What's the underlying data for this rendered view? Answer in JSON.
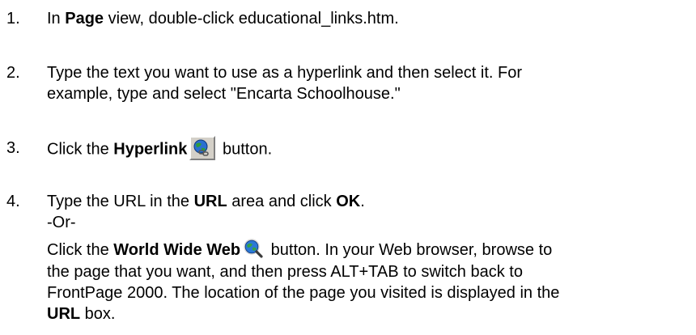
{
  "steps": [
    {
      "number": "1.",
      "p1": "In ",
      "b1": "Page",
      "p2": " view, double-click educational_links.htm."
    },
    {
      "number": "2.",
      "line1": "Type the text you want to use as a hyperlink and then select it. For",
      "line2": "example, type and select \"Encarta Schoolhouse.\""
    },
    {
      "number": "3.",
      "p1": "Click the ",
      "b1": "Hyperlink",
      "icon": "hyperlink-globe-chain-icon",
      "p2": " button."
    },
    {
      "number": "4.",
      "p1": "Type the URL in the ",
      "b1": "URL",
      "p2": " area and click ",
      "b2": "OK",
      "p3": ".",
      "or": "-Or-",
      "c1": "Click the ",
      "cb1": "World Wide Web",
      "icon": "world-wide-web-globe-magnifier-icon",
      "c2": " button. In your Web browser, browse to",
      "c3": "the page that you want, and then press ALT+TAB to switch back to",
      "c4": "FrontPage 2000. The location of the page you visited is displayed in the",
      "cb2": "URL",
      "c5": " box."
    }
  ]
}
